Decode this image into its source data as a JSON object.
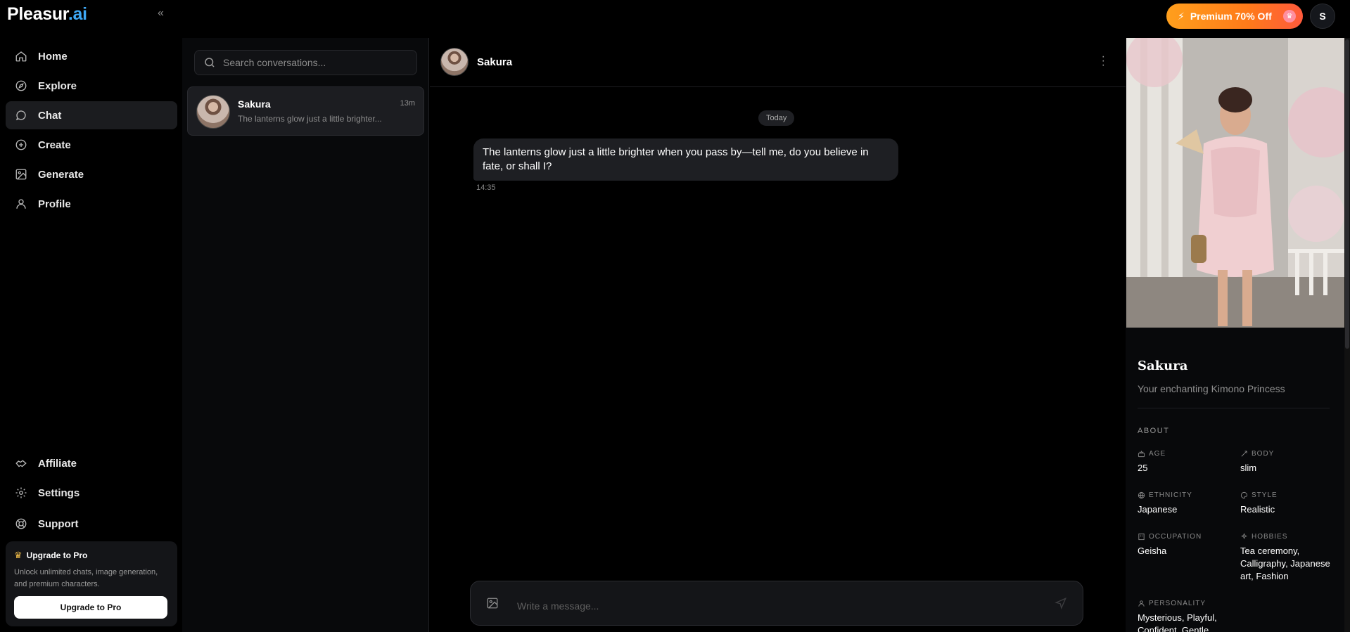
{
  "brand": {
    "name": "Pleasur",
    "suffix": ".ai"
  },
  "topbar": {
    "premium_label": "Premium 70% Off",
    "user_initial": "S"
  },
  "nav": {
    "items": [
      {
        "label": "Home",
        "icon": "home-icon"
      },
      {
        "label": "Explore",
        "icon": "compass-icon"
      },
      {
        "label": "Chat",
        "icon": "chat-bubble-icon",
        "active": true
      },
      {
        "label": "Create",
        "icon": "plus-circle-icon"
      },
      {
        "label": "Generate",
        "icon": "image-icon"
      },
      {
        "label": "Profile",
        "icon": "user-icon"
      }
    ],
    "bottom": [
      {
        "label": "Affiliate",
        "icon": "handshake-icon"
      },
      {
        "label": "Settings",
        "icon": "gear-icon"
      },
      {
        "label": "Support",
        "icon": "lifebuoy-icon"
      }
    ]
  },
  "upgrade": {
    "title": "Upgrade to Pro",
    "description": "Unlock unlimited chats, image generation, and premium characters.",
    "button": "Upgrade to Pro"
  },
  "conversations": {
    "search_placeholder": "Search conversations...",
    "items": [
      {
        "name": "Sakura",
        "preview": "The lanterns glow just a little brighter...",
        "time": "13m"
      }
    ]
  },
  "chat": {
    "contact_name": "Sakura",
    "date_label": "Today",
    "messages": [
      {
        "text": "The lanterns glow just a little brighter when you pass by—tell me, do you believe in fate, or shall I?",
        "time": "14:35"
      }
    ],
    "composer_placeholder": "Write a message..."
  },
  "profile": {
    "name": "Sakura",
    "tagline": "Your enchanting Kimono Princess",
    "section": "ABOUT",
    "attributes": {
      "age": {
        "label": "AGE",
        "value": "25"
      },
      "body": {
        "label": "BODY",
        "value": "slim"
      },
      "ethnicity": {
        "label": "ETHNICITY",
        "value": "Japanese"
      },
      "style": {
        "label": "STYLE",
        "value": "Realistic"
      },
      "occupation": {
        "label": "OCCUPATION",
        "value": "Geisha"
      },
      "hobbies": {
        "label": "HOBBIES",
        "value": "Tea ceremony, Calligraphy, Japanese art, Fashion"
      },
      "personality": {
        "label": "PERSONALITY",
        "value": "Mysterious, Playful, Confident, Gentle"
      }
    }
  },
  "colors": {
    "accent": "#3ea8f5",
    "premium_start": "#ff9f1c",
    "premium_end": "#ff5a3c",
    "background": "#000000"
  }
}
